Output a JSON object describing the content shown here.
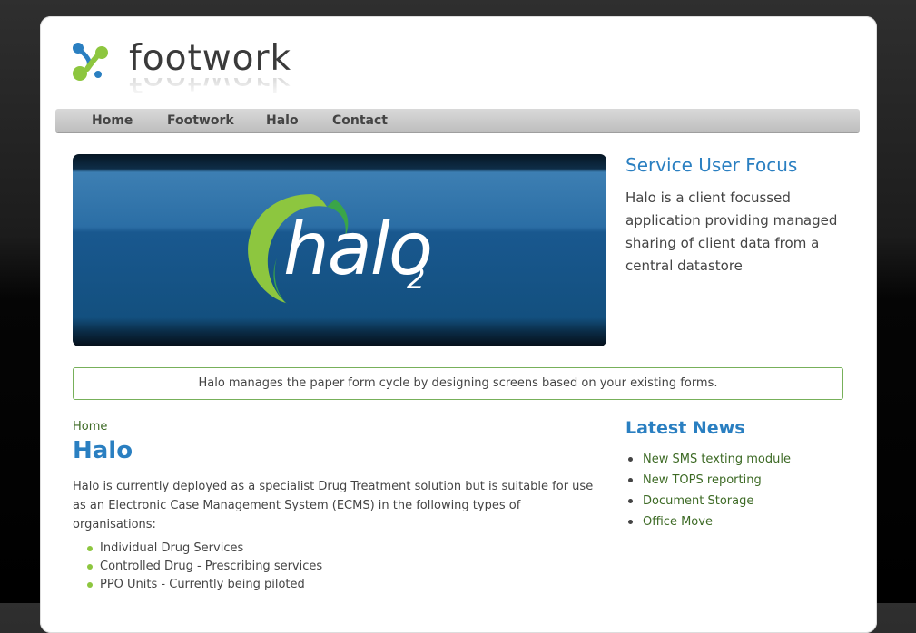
{
  "logo": {
    "text": "footwork"
  },
  "nav": {
    "items": [
      {
        "label": "Home"
      },
      {
        "label": "Footwork"
      },
      {
        "label": "Halo"
      },
      {
        "label": "Contact"
      }
    ]
  },
  "banner": {
    "text": "halo",
    "subscript": "2"
  },
  "side": {
    "title": "Service User Focus",
    "text": "Halo is a client focussed application providing managed sharing of client data from a central datastore"
  },
  "highlight": {
    "text": "Halo manages the paper form cycle by designing screens based on your existing forms."
  },
  "main": {
    "breadcrumb": "Home",
    "title": "Halo",
    "text": "Halo is currently deployed as a specialist Drug Treatment solution but is suitable for use as an Electronic Case Management System (ECMS) in the following types of organisations:",
    "bullets": [
      "Individual Drug Services",
      "Controlled Drug - Prescribing services",
      "PPO Units - Currently being piloted"
    ]
  },
  "news": {
    "title": "Latest News",
    "items": [
      "New SMS texting module",
      "New TOPS reporting",
      "Document Storage",
      "Office Move"
    ]
  },
  "colors": {
    "accent_blue": "#2a7fc1",
    "accent_green": "#8dc63f",
    "link_green": "#3d6a25"
  }
}
